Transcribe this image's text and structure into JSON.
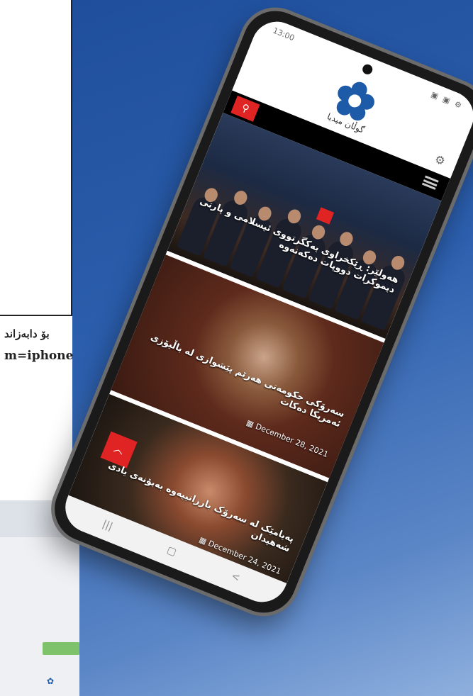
{
  "side_text": {
    "line1": "بۆ دابەزاند",
    "line2": "m=iphone"
  },
  "status_bar": {
    "time": "13:00",
    "icons": "▣ ▣ ⚙"
  },
  "header": {
    "logo_text": "گوڵان میدیا",
    "logo_icon": "flower-icon",
    "settings_icon": "gear-icon"
  },
  "navbar": {
    "search_icon": "search-icon",
    "menu_icon": "hamburger-icon"
  },
  "articles": [
    {
      "title": "هەولێر: ڕێکخراوی یەکگرتووی ئیسلامی و پارتی دیموکرات دووپات دەکەنەوە",
      "tag_color": "#e02424"
    },
    {
      "title": "سەرۆکی حکومەتی هەرێم پێشوازی لە باڵیۆزی ئەمریکا دەکات",
      "date": "December 28, 2021"
    },
    {
      "title": "پەیامێک لە سەرۆک بارزانییەوە بەبۆنەی یادی شەهیدان",
      "date": "December 24, 2021"
    }
  ],
  "scroll_top_icon": "chevron-up-icon",
  "bottom_nav": {
    "recent_icon": "recents-icon",
    "home_icon": "home-icon",
    "back_icon": "back-icon",
    "recent_glyph": "|||",
    "home_glyph": "▢",
    "back_glyph": "<"
  },
  "colors": {
    "accent": "#e02424",
    "background_blue": "#2c5fae",
    "navbar": "#000000"
  }
}
